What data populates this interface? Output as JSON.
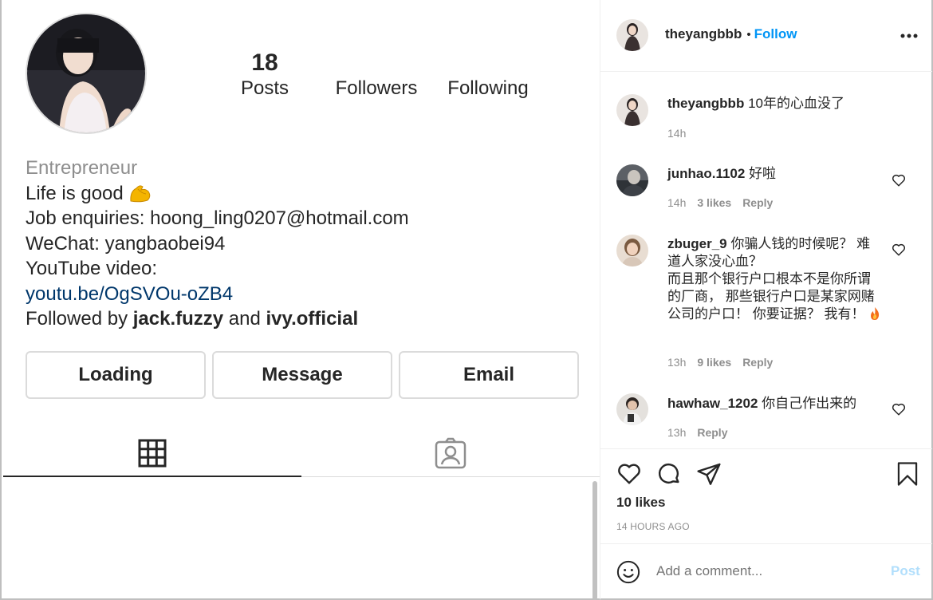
{
  "profile": {
    "posts_count": "18",
    "posts_label": "Posts",
    "followers_label": "Followers",
    "following_label": "Following",
    "category": "Entrepreneur",
    "bio_line1": "Life is good",
    "bio_line2": "Job enquiries: hoong_ling0207@hotmail.com",
    "bio_line3": "WeChat: yangbaobei94",
    "bio_line4": "YouTube video:",
    "bio_link": "youtu.be/OgSVOu-oZB4",
    "followed_by_prefix": "Followed by",
    "followed_by_user1": "jack.fuzzy",
    "followed_by_and": "and",
    "followed_by_user2": "ivy.official"
  },
  "buttons": {
    "loading": "Loading",
    "message": "Message",
    "email": "Email"
  },
  "tabs": [
    {
      "icon": "grid-icon",
      "active": true
    },
    {
      "icon": "tagged-icon",
      "active": false
    }
  ],
  "post": {
    "author": "theyangbbb",
    "separator": "•",
    "follow_label": "Follow",
    "more_icon": "more-horizontal-icon",
    "likes": "10 likes",
    "time_ago": "14 HOURS AGO"
  },
  "comments": [
    {
      "user": "theyangbbb",
      "text": "10年的心血没了",
      "time": "14h",
      "likes": "",
      "reply": ""
    },
    {
      "user": "junhao.1102",
      "text": "好啦",
      "time": "14h",
      "likes": "3 likes",
      "reply": "Reply"
    },
    {
      "user": "zbuger_9",
      "text": "你骗人钱的时候呢？ 难道人家没心血？",
      "text2": "而且那个银行户口根本不是你所谓的厂商， 那些银行户口是某家网赌公司的户口！ 你要证据？ 我有！",
      "time": "13h",
      "likes": "9 likes",
      "reply": "Reply"
    },
    {
      "user": "hawhaw_1202",
      "text": "你自己作出来的",
      "time": "13h",
      "likes": "",
      "reply": "Reply"
    }
  ],
  "add_comment": {
    "placeholder": "Add a comment...",
    "post_label": "Post"
  },
  "colors": {
    "accent": "#0095f6",
    "post_disabled": "#b2dffc",
    "link": "#00376b"
  }
}
